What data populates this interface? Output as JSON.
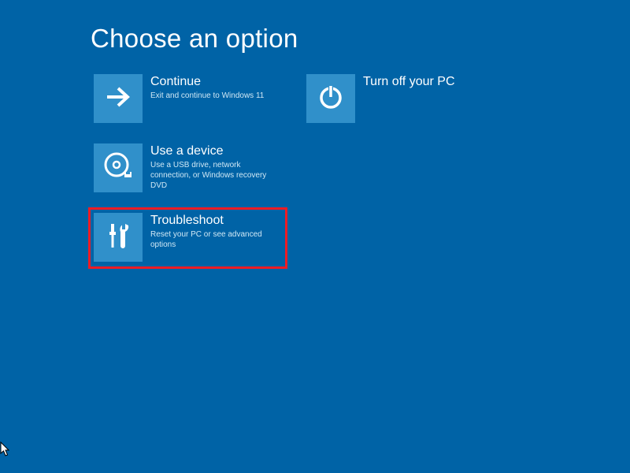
{
  "title": "Choose an option",
  "options": {
    "continue": {
      "title": "Continue",
      "desc": "Exit and continue to Windows 11"
    },
    "turnoff": {
      "title": "Turn off your PC",
      "desc": ""
    },
    "device": {
      "title": "Use a device",
      "desc": "Use a USB drive, network connection, or Windows recovery DVD"
    },
    "troubleshoot": {
      "title": "Troubleshoot",
      "desc": "Reset your PC or see advanced options"
    }
  },
  "colors": {
    "background": "#0063a6",
    "tile": "#3090ca",
    "highlight": "#ee1c25"
  }
}
